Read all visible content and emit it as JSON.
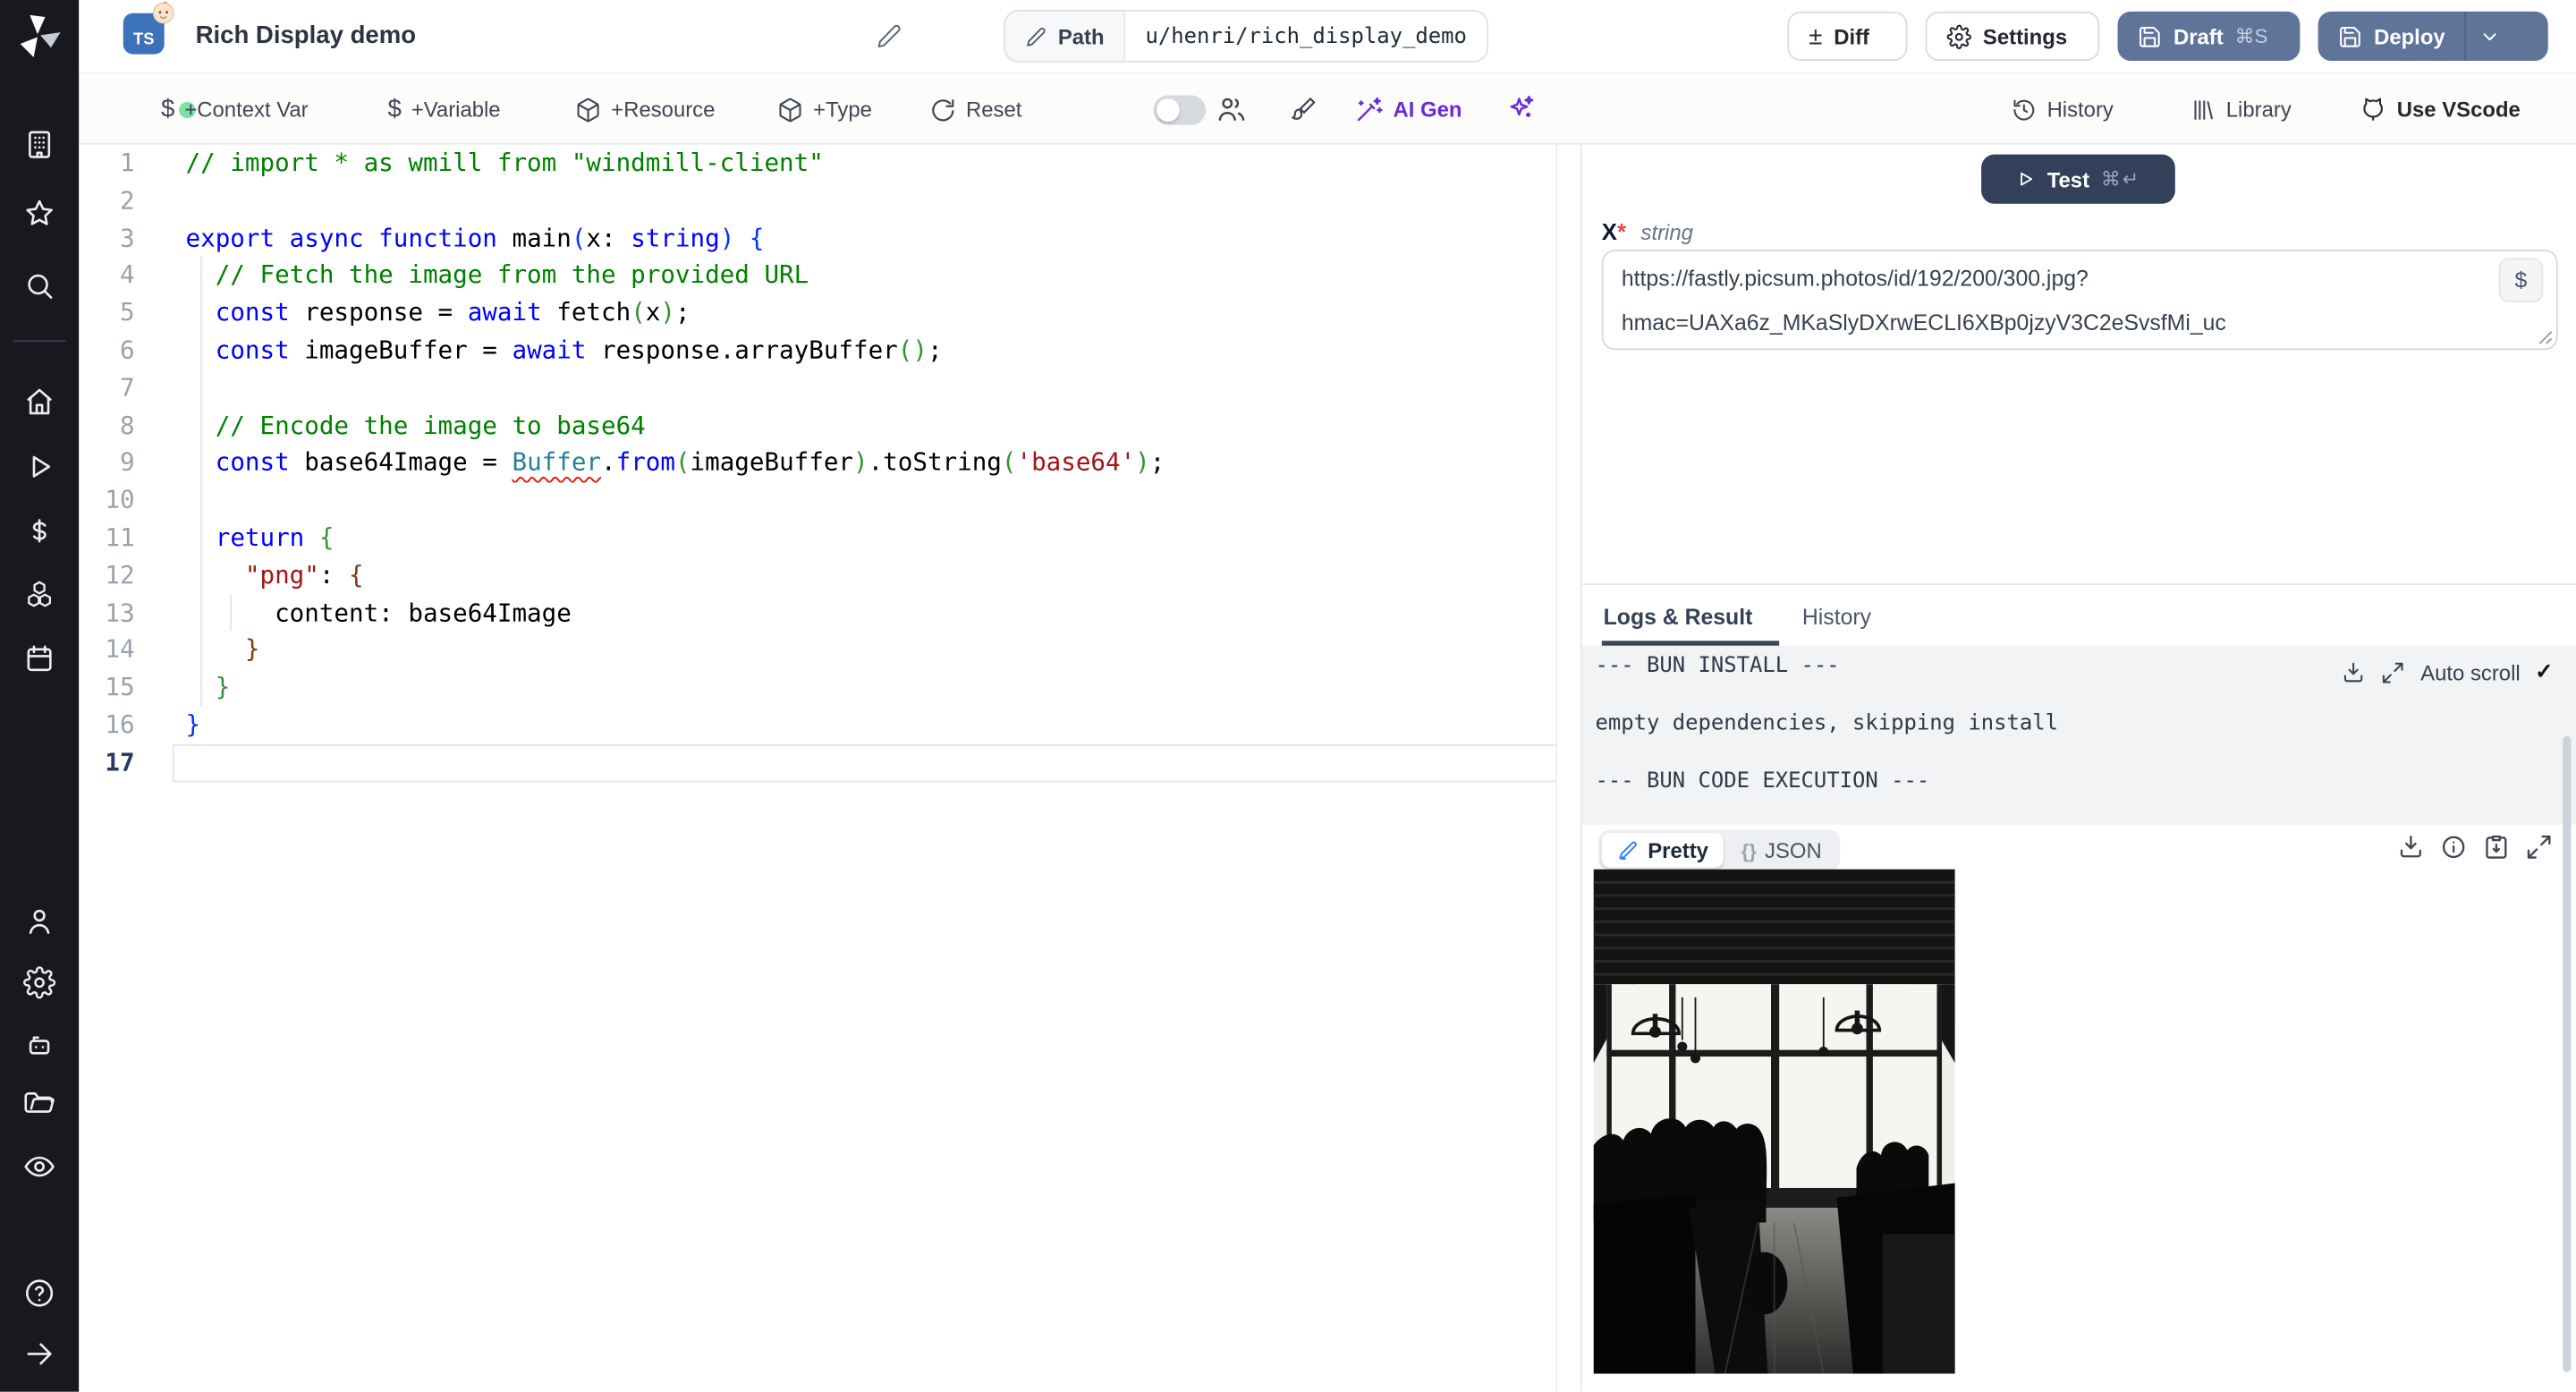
{
  "header": {
    "lang_badge": "TS",
    "emoji_badge": "baby-face-emoji",
    "title": "Rich Display demo",
    "path": {
      "label": "Path",
      "value": "u/henri/rich_display_demo"
    },
    "actions": {
      "diff": "Diff",
      "diff_glyph": "±",
      "settings": "Settings",
      "draft": "Draft",
      "draft_shortcut": "⌘S",
      "deploy": "Deploy"
    }
  },
  "toolbar": {
    "add_context_var": "+Context Var",
    "add_variable": "+Variable",
    "add_resource": "+Resource",
    "add_type": "+Type",
    "reset": "Reset",
    "dollar_glyph": "$",
    "ai_gen": "AI Gen",
    "history": "History",
    "library": "Library",
    "use_vscode": "Use VScode"
  },
  "editor": {
    "lines": [
      {
        "n": 1,
        "segs": [
          [
            "cm",
            "// import * as wmill from \"windmill-client\""
          ]
        ]
      },
      {
        "n": 2,
        "segs": []
      },
      {
        "n": 3,
        "segs": [
          [
            "kw",
            "export async function "
          ],
          [
            "tx",
            "main"
          ],
          [
            "b1",
            "("
          ],
          [
            "tx",
            "x: "
          ],
          [
            "kw",
            "string"
          ],
          [
            "b1",
            ")"
          ],
          [
            "tx",
            " "
          ],
          [
            "b1",
            "{"
          ]
        ]
      },
      {
        "n": 4,
        "segs": [
          [
            "cm",
            "  // Fetch the image from the provided URL"
          ]
        ]
      },
      {
        "n": 5,
        "segs": [
          [
            "tx",
            "  "
          ],
          [
            "kw",
            "const"
          ],
          [
            "tx",
            " response = "
          ],
          [
            "kw",
            "await"
          ],
          [
            "tx",
            " fetch"
          ],
          [
            "b2",
            "("
          ],
          [
            "tx",
            "x"
          ],
          [
            "b2",
            ")"
          ],
          [
            "tx",
            ";"
          ]
        ]
      },
      {
        "n": 6,
        "segs": [
          [
            "tx",
            "  "
          ],
          [
            "kw",
            "const"
          ],
          [
            "tx",
            " imageBuffer = "
          ],
          [
            "kw",
            "await"
          ],
          [
            "tx",
            " response.arrayBuffer"
          ],
          [
            "b2",
            "()"
          ],
          [
            "tx",
            ";"
          ]
        ]
      },
      {
        "n": 7,
        "segs": []
      },
      {
        "n": 8,
        "segs": [
          [
            "cm",
            "  // Encode the image to base64"
          ]
        ]
      },
      {
        "n": 9,
        "segs": [
          [
            "tx",
            "  "
          ],
          [
            "kw",
            "const"
          ],
          [
            "tx",
            " base64Image = "
          ],
          [
            "errtyp",
            "Buffer"
          ],
          [
            "tx",
            "."
          ],
          [
            "kw",
            "from"
          ],
          [
            "b2",
            "("
          ],
          [
            "tx",
            "imageBuffer"
          ],
          [
            "b2",
            ")"
          ],
          [
            "tx",
            ".toString"
          ],
          [
            "b2",
            "("
          ],
          [
            "str",
            "'base64'"
          ],
          [
            "b2",
            ")"
          ],
          [
            "tx",
            ";"
          ]
        ]
      },
      {
        "n": 10,
        "segs": []
      },
      {
        "n": 11,
        "segs": [
          [
            "tx",
            "  "
          ],
          [
            "kw",
            "return"
          ],
          [
            "tx",
            " "
          ],
          [
            "b2",
            "{"
          ]
        ]
      },
      {
        "n": 12,
        "segs": [
          [
            "tx",
            "    "
          ],
          [
            "str",
            "\"png\""
          ],
          [
            "tx",
            ": "
          ],
          [
            "b3",
            "{"
          ]
        ]
      },
      {
        "n": 13,
        "segs": [
          [
            "tx",
            "      content: base64Image"
          ]
        ]
      },
      {
        "n": 14,
        "segs": [
          [
            "tx",
            "    "
          ],
          [
            "b3",
            "}"
          ]
        ]
      },
      {
        "n": 15,
        "segs": [
          [
            "tx",
            "  "
          ],
          [
            "b2",
            "}"
          ]
        ]
      },
      {
        "n": 16,
        "segs": [
          [
            "b1",
            "}"
          ]
        ]
      },
      {
        "n": 17,
        "segs": [],
        "current": true
      }
    ]
  },
  "run": {
    "test": "Test",
    "test_shortcut": "⌘↵"
  },
  "args": {
    "name": "x",
    "required_mark": "*",
    "type": "string",
    "value_line1": "https://fastly.picsum.photos/id/192/200/300.jpg?",
    "value_line2": "hmac=UAXa6z_MKaSlyDXrwECLI6XBp0jzyV3C2eSvsfMi_uc",
    "var_picker": "$"
  },
  "output": {
    "tabs": [
      "Logs & Result",
      "History"
    ],
    "logs": [
      "--- BUN INSTALL ---",
      "empty dependencies, skipping install",
      "--- BUN CODE EXECUTION ---"
    ],
    "auto_scroll": "Auto scroll",
    "check": "✓",
    "view_pretty": "Pretty",
    "view_json": "JSON",
    "json_glyph": "{}"
  },
  "sidebar": {
    "icons": [
      "windmill-logo",
      "workspace",
      "favorites",
      "search",
      "home",
      "runs",
      "variables",
      "resources",
      "schedules",
      "user",
      "settings",
      "workers",
      "folders",
      "audit-logs",
      "help",
      "expand-sidebar"
    ]
  },
  "colors": {
    "rail_bg": "#17191e",
    "accent_slate": "#5f7499",
    "test_button": "#33405a",
    "ai_purple": "#6d28d9",
    "status_green": "#7fdfa4",
    "error_red": "#ef6f6f",
    "ts_blue": "#3b72b8"
  }
}
